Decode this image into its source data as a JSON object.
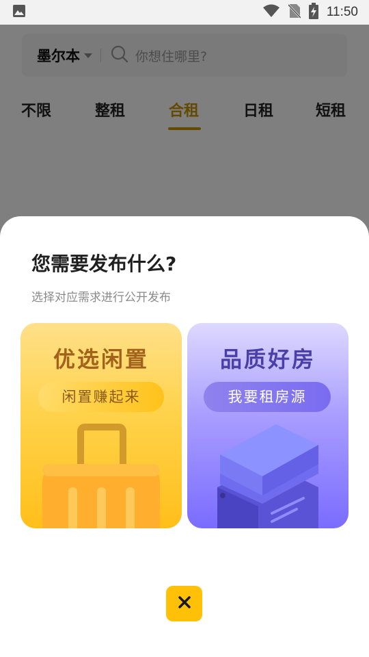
{
  "status_bar": {
    "time": "11:50",
    "icons": [
      "image-icon",
      "wifi-icon",
      "no-sim-icon",
      "battery-charging-icon"
    ]
  },
  "app": {
    "search": {
      "city": "墨尔本",
      "placeholder": "你想住哪里?"
    },
    "tabs": [
      {
        "label": "不限"
      },
      {
        "label": "整租"
      },
      {
        "label": "合租",
        "active": true
      },
      {
        "label": "日租"
      },
      {
        "label": "短租"
      }
    ],
    "active_color": "#c89400"
  },
  "sheet": {
    "title": "您需要发布什么?",
    "subtitle": "选择对应需求进行公开发布",
    "cards": [
      {
        "title": "优选闲置",
        "button": "闲置赚起来",
        "illustration": "suitcase-illustration"
      },
      {
        "title": "品质好房",
        "button": "我要租房源",
        "illustration": "building-illustration"
      }
    ],
    "close_icon": "close-icon",
    "accent": "#ffc107"
  }
}
